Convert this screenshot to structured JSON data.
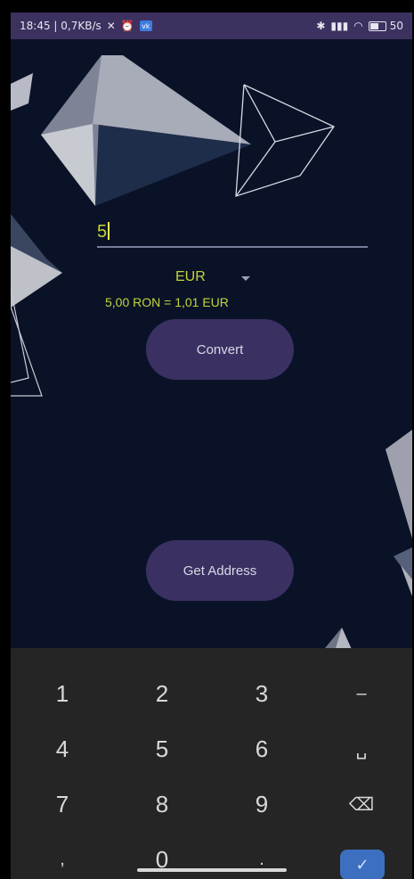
{
  "status_bar": {
    "time_speed": "18:45 | 0,7KB/s",
    "vk_label": "vk",
    "battery": "50"
  },
  "converter": {
    "amount": "5",
    "currency": "EUR",
    "result": "5,00 RON = 1,01 EUR",
    "convert_label": "Convert",
    "address_label": "Get Address"
  },
  "keyboard": {
    "keys": [
      "1",
      "2",
      "3",
      "–",
      "4",
      "5",
      "6",
      "␣",
      "7",
      "8",
      "9",
      "⌫",
      ",",
      "0",
      ".",
      "✓"
    ]
  },
  "colors": {
    "background": "#0a1227",
    "statusbar": "#3d3160",
    "button": "#3a3162",
    "accent_text": "#c2d53a",
    "keyboard": "#252525",
    "done_key": "#3d6fc0"
  }
}
